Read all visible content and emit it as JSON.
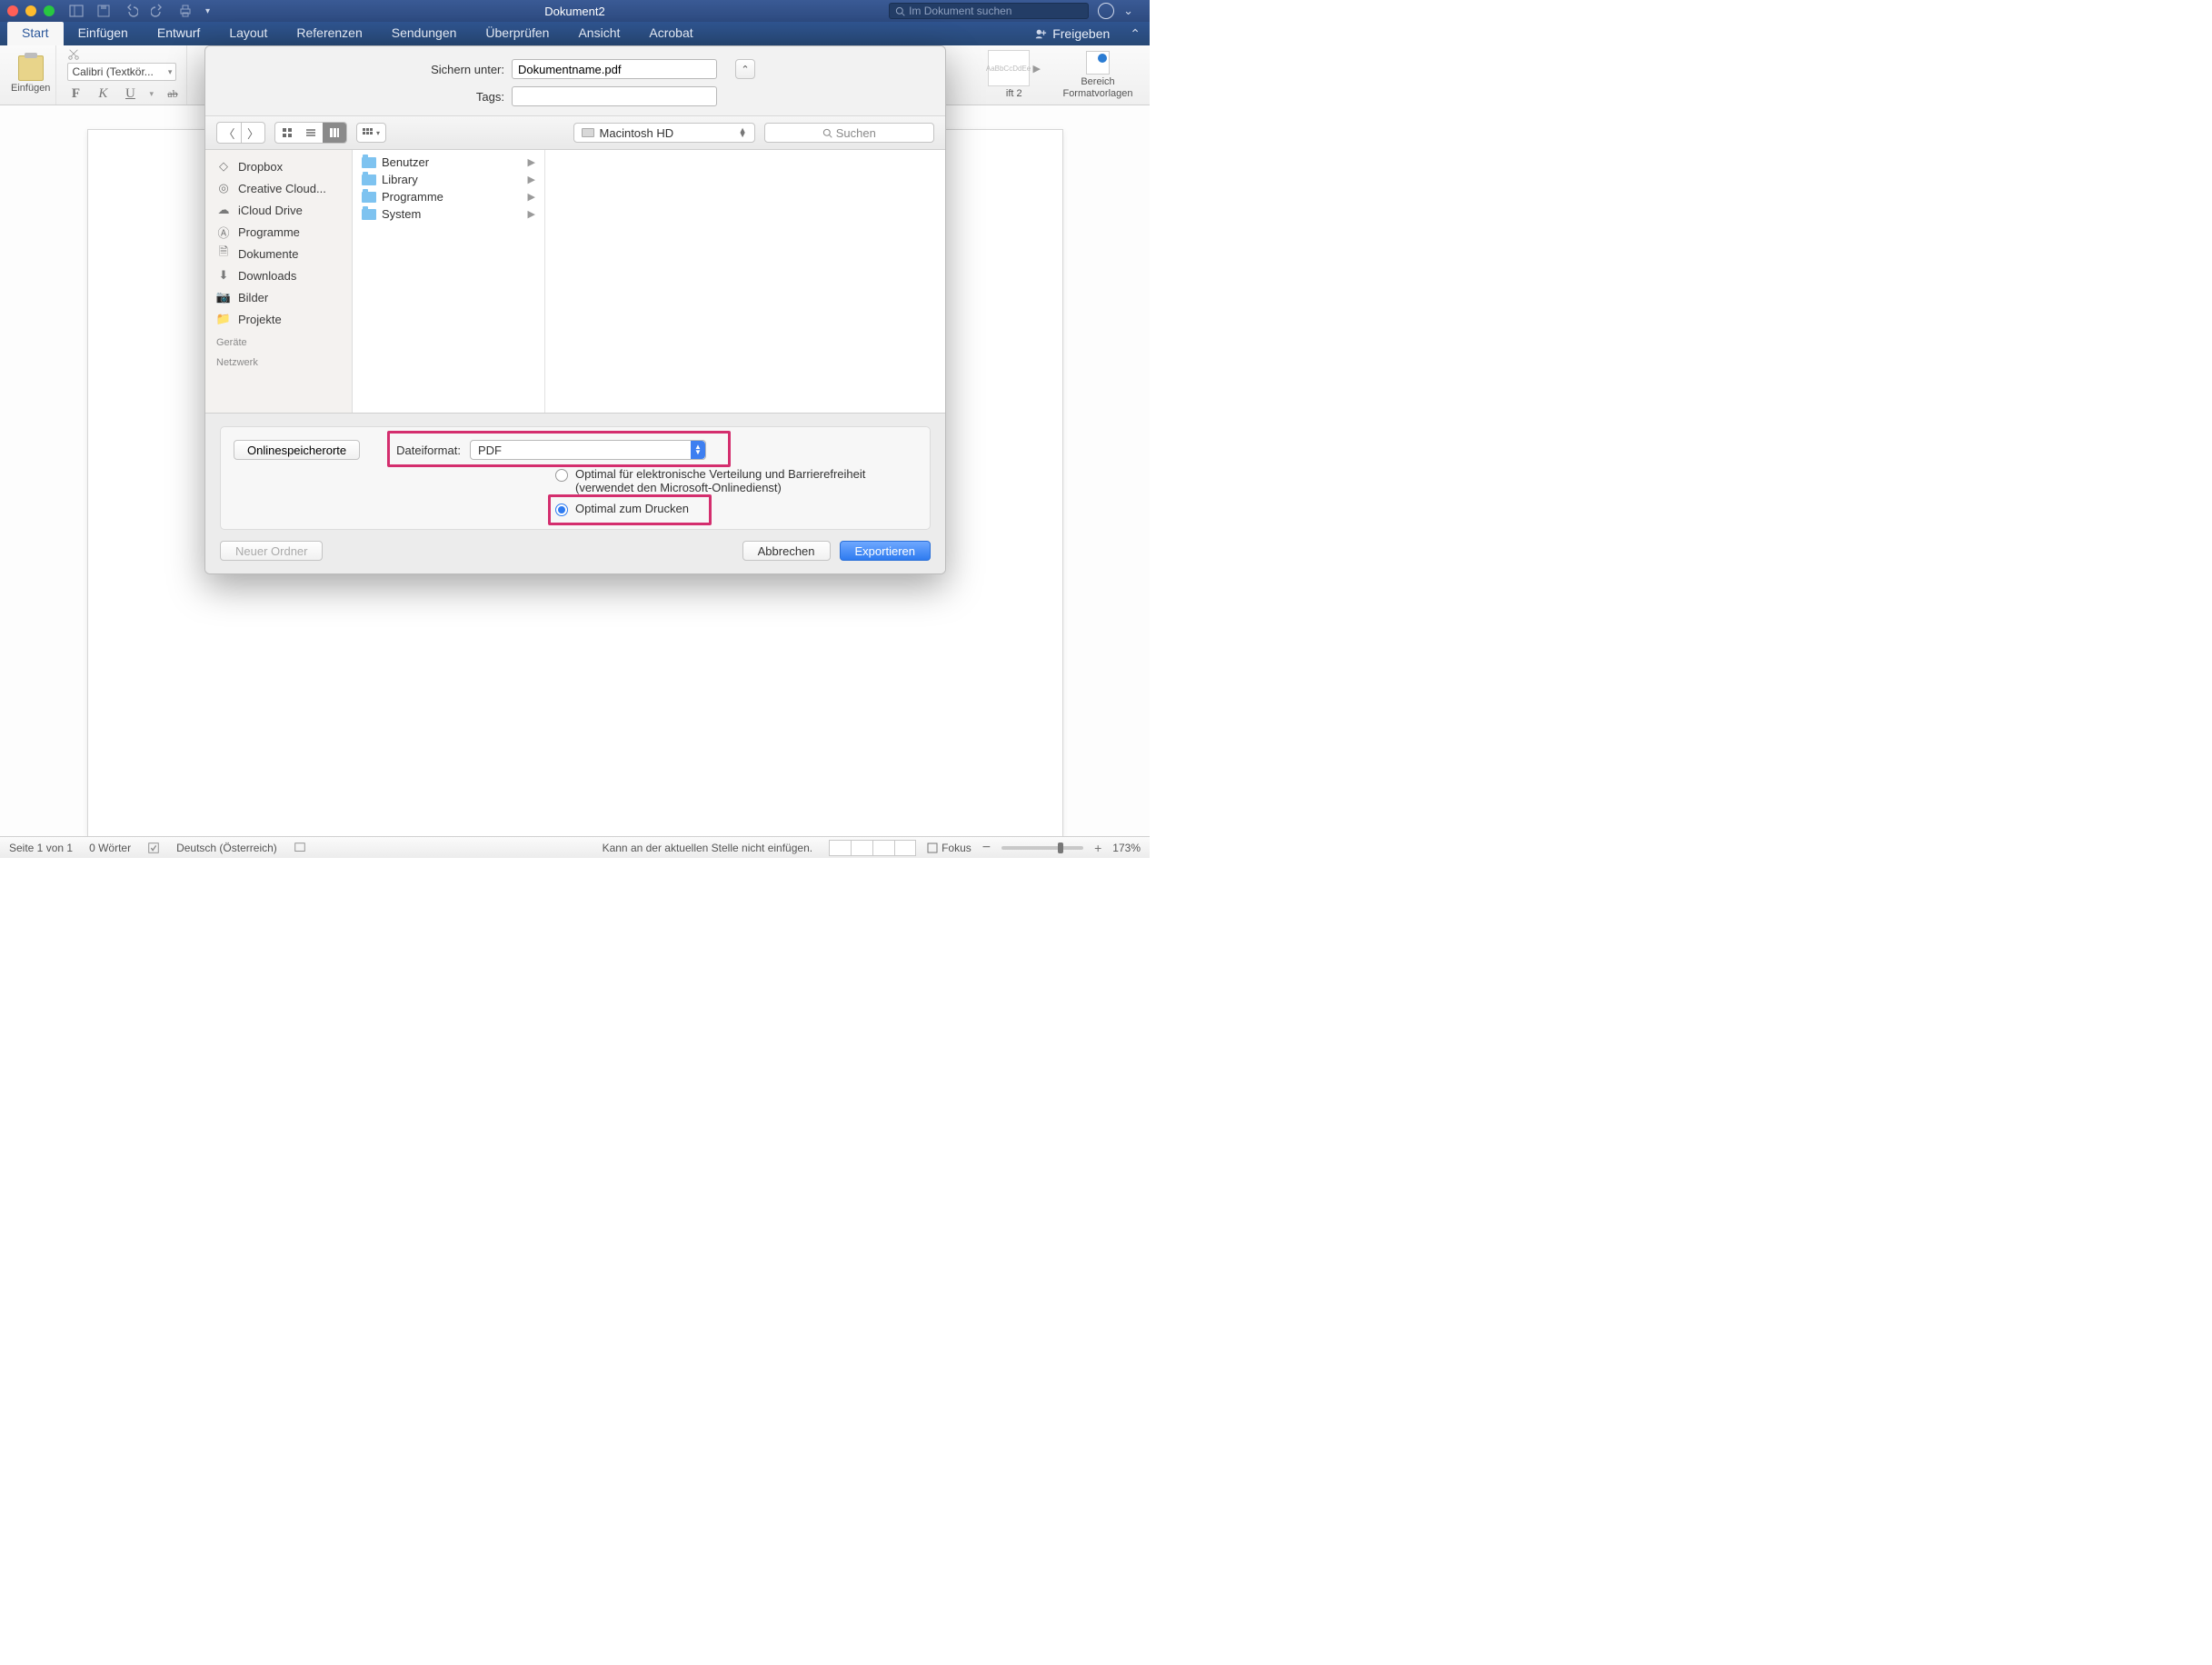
{
  "titlebar": {
    "title": "Dokument2",
    "search_placeholder": "Im Dokument suchen"
  },
  "ribbon_tabs": {
    "items": [
      "Start",
      "Einfügen",
      "Entwurf",
      "Layout",
      "Referenzen",
      "Sendungen",
      "Überprüfen",
      "Ansicht",
      "Acrobat"
    ],
    "share": "Freigeben"
  },
  "ribbon": {
    "paste": "Einfügen",
    "font": "Calibri (Textkör...",
    "bold": "F",
    "italic": "K",
    "underline": "U",
    "strike": "ab",
    "style_preview": "AaBbCcDdEe",
    "style_name": "ift 2",
    "pane": "Bereich Formatvorlagen"
  },
  "dialog": {
    "save_as_label": "Sichern unter:",
    "filename": "Dokumentname.pdf",
    "tags_label": "Tags:",
    "location": "Macintosh HD",
    "search_placeholder": "Suchen",
    "favorites": [
      {
        "icon": "dropbox",
        "label": "Dropbox"
      },
      {
        "icon": "cc",
        "label": "Creative Cloud..."
      },
      {
        "icon": "cloud",
        "label": "iCloud Drive"
      },
      {
        "icon": "apps",
        "label": "Programme"
      },
      {
        "icon": "docs",
        "label": "Dokumente"
      },
      {
        "icon": "downloads",
        "label": "Downloads"
      },
      {
        "icon": "pictures",
        "label": "Bilder"
      },
      {
        "icon": "folder",
        "label": "Projekte"
      }
    ],
    "fav_headers": {
      "devices": "Geräte",
      "network": "Netzwerk"
    },
    "column_items": [
      "Benutzer",
      "Library",
      "Programme",
      "System"
    ],
    "online_button": "Onlinespeicherorte",
    "file_format_label": "Dateiformat:",
    "file_format_value": "PDF",
    "radio1": "Optimal für elektronische Verteilung und Barrierefreiheit",
    "radio1_sub": "(verwendet den Microsoft-Onlinedienst)",
    "radio2": "Optimal zum Drucken",
    "new_folder": "Neuer Ordner",
    "cancel": "Abbrechen",
    "export": "Exportieren"
  },
  "status": {
    "page": "Seite 1 von 1",
    "words": "0 Wörter",
    "lang": "Deutsch (Österreich)",
    "insert_msg": "Kann an der aktuellen Stelle nicht einfügen.",
    "focus": "Fokus",
    "zoom": "173%"
  }
}
